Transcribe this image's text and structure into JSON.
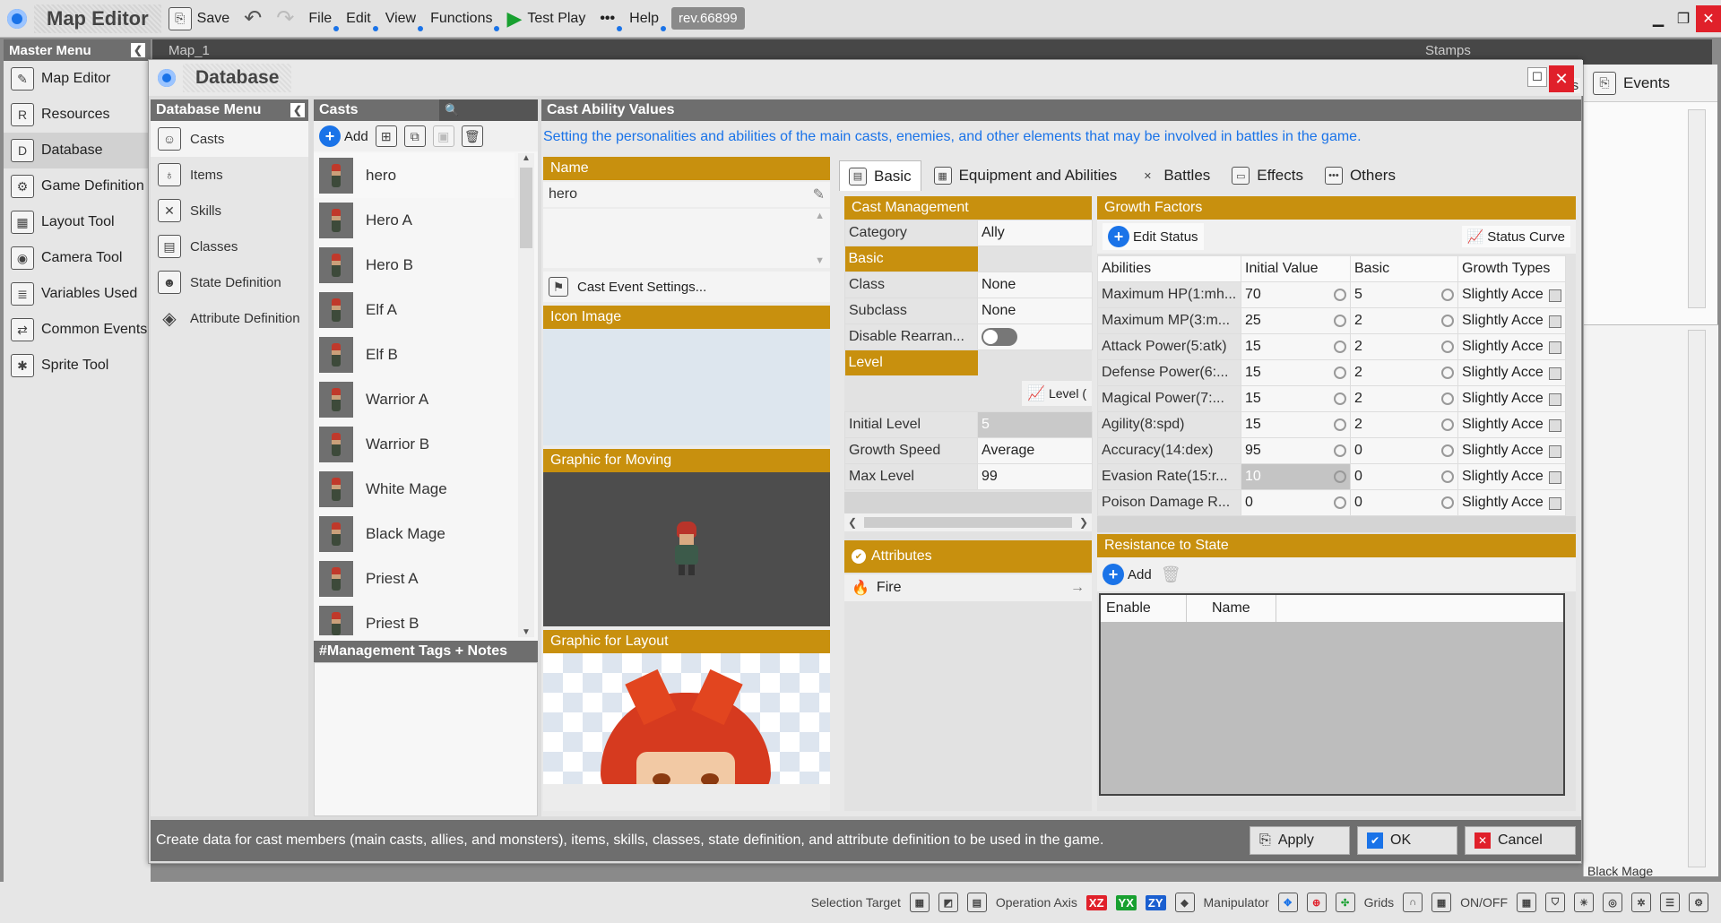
{
  "app": {
    "title": "Map Editor",
    "save": "Save",
    "menus": [
      "File",
      "Edit",
      "View",
      "Functions"
    ],
    "test_play": "Test Play",
    "more": "•••",
    "help": "Help",
    "rev": "rev.66899"
  },
  "master_menu": {
    "title": "Master Menu",
    "items": [
      "Map Editor",
      "Resources",
      "Database",
      "Game Definition",
      "Layout Tool",
      "Camera Tool",
      "Variables Used",
      "Common Events",
      "Sprite Tool"
    ]
  },
  "map_tab": "Map_1",
  "stamps": "Stamps",
  "events_tab": "Events",
  "events_partial": "cts",
  "black_mage_partial": "Black Mage",
  "database": {
    "title": "Database",
    "menu_title": "Database Menu",
    "menu": [
      "Casts",
      "Items",
      "Skills",
      "Classes",
      "State Definition",
      "Attribute Definition"
    ],
    "casts_title": "Casts",
    "add": "Add",
    "casts": [
      "hero",
      "Hero A",
      "Hero B",
      "Elf A",
      "Elf B",
      "Warrior A",
      "Warrior B",
      "White Mage",
      "Black Mage",
      "Priest A",
      "Priest B"
    ],
    "mgmt_tags": "#Management Tags + Notes",
    "section_title": "Cast Ability Values",
    "description": "Setting the personalities and abilities of the main casts, enemies, and other elements that may be involved in battles in the game.",
    "name_label": "Name",
    "name_value": "hero",
    "cast_event": "Cast Event Settings...",
    "icon_image": "Icon Image",
    "graphic_moving": "Graphic for Moving",
    "graphic_layout": "Graphic for Layout",
    "tabs": [
      "Basic",
      "Equipment and Abilities",
      "Battles",
      "Effects",
      "Others"
    ],
    "cast_mgmt": "Cast Management",
    "category_label": "Category",
    "category_value": "Ally",
    "basic": "Basic",
    "class_label": "Class",
    "class_value": "None",
    "subclass_label": "Subclass",
    "subclass_value": "None",
    "disable_label": "Disable Rearran...",
    "level": "Level",
    "level_btn": "Level (",
    "initial_level_label": "Initial Level",
    "initial_level_value": "5",
    "growth_speed_label": "Growth Speed",
    "growth_speed_value": "Average",
    "max_level_label": "Max Level",
    "max_level_value": "99",
    "attributes": "Attributes",
    "fire": "Fire",
    "growth": "Growth Factors",
    "edit_status": "Edit Status",
    "status_curve": "Status Curve",
    "cols": [
      "Abilities",
      "Initial Value",
      "Basic",
      "Growth Types"
    ],
    "rows": [
      [
        "Maximum HP(1:mh...",
        "70",
        "5",
        "Slightly Acce"
      ],
      [
        "Maximum MP(3:m...",
        "25",
        "2",
        "Slightly Acce"
      ],
      [
        "Attack Power(5:atk)",
        "15",
        "2",
        "Slightly Acce"
      ],
      [
        "Defense Power(6:...",
        "15",
        "2",
        "Slightly Acce"
      ],
      [
        "Magical Power(7:...",
        "15",
        "2",
        "Slightly Acce"
      ],
      [
        "Agility(8:spd)",
        "15",
        "2",
        "Slightly Acce"
      ],
      [
        "Accuracy(14:dex)",
        "95",
        "0",
        "Slightly Acce"
      ],
      [
        "Evasion Rate(15:r...",
        "10",
        "0",
        "Slightly Acce"
      ],
      [
        "Poison Damage R...",
        "0",
        "0",
        "Slightly Acce"
      ]
    ],
    "resistance": "Resistance to State",
    "res_cols": [
      "Enable",
      "Name"
    ],
    "help": "Create data for cast members (main casts, allies, and monsters), items, skills, classes, state definition, and attribute definition to be used in the game.",
    "apply": "Apply",
    "ok": "OK",
    "cancel": "Cancel"
  },
  "statusbar": {
    "selection_target": "Selection Target",
    "operation_axis": "Operation Axis",
    "xz": "XZ",
    "yx": "YX",
    "zy": "ZY",
    "manipulator": "Manipulator",
    "grids": "Grids",
    "onoff": "ON/OFF"
  },
  "colors": {
    "gold": "#c8900e",
    "blue": "#1a73e8",
    "red": "#e0202a"
  }
}
